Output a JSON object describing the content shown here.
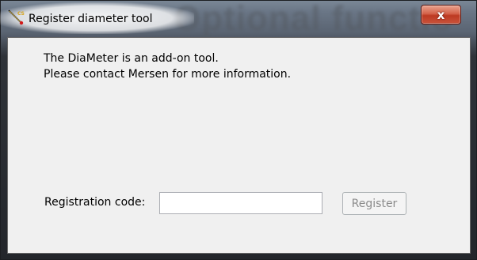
{
  "window": {
    "title": "Register diameter tool",
    "background_title": "Optional functio",
    "close_glyph": "x",
    "close_color": "#c9462d"
  },
  "message": {
    "line1": "The DiaMeter is an add-on tool.",
    "line2": "Please contact Mersen for more information."
  },
  "registration": {
    "label": "Registration code:",
    "value": "",
    "button_label": "Register",
    "button_enabled": false
  },
  "icons": {
    "app_icon": "diameter-tool-icon"
  }
}
